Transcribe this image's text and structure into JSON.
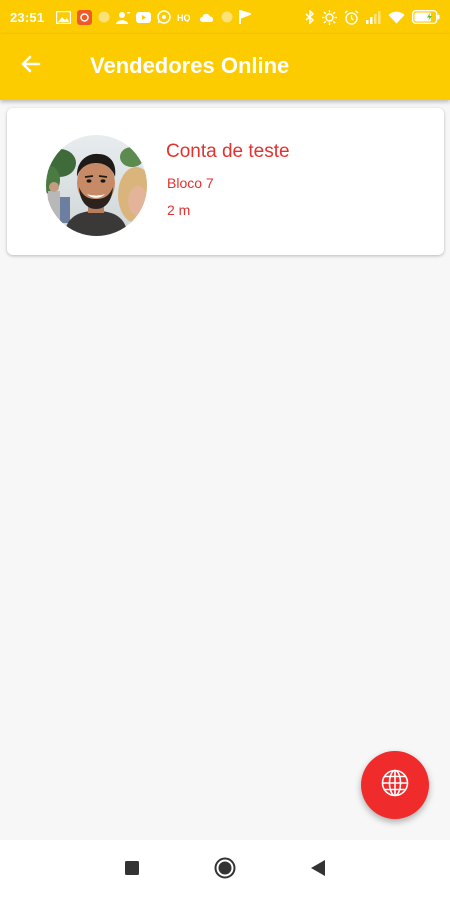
{
  "status_bar": {
    "time": "23:51",
    "battery_level_percent": 80
  },
  "app_bar": {
    "title": "Vendedores Online",
    "back_icon": "arrow-back-icon"
  },
  "sellers": [
    {
      "name": "Conta de teste",
      "location": "Bloco 7",
      "distance": "2 m"
    }
  ],
  "fab": {
    "icon": "globe-icon"
  },
  "nav_bar": {
    "icons": [
      "recents-square-icon",
      "home-circle-icon",
      "back-triangle-icon"
    ]
  },
  "colors": {
    "primary": "#fccb00",
    "accent": "#ef2b2b",
    "text_accent": "#e53030",
    "background": "#f7f7f7"
  }
}
